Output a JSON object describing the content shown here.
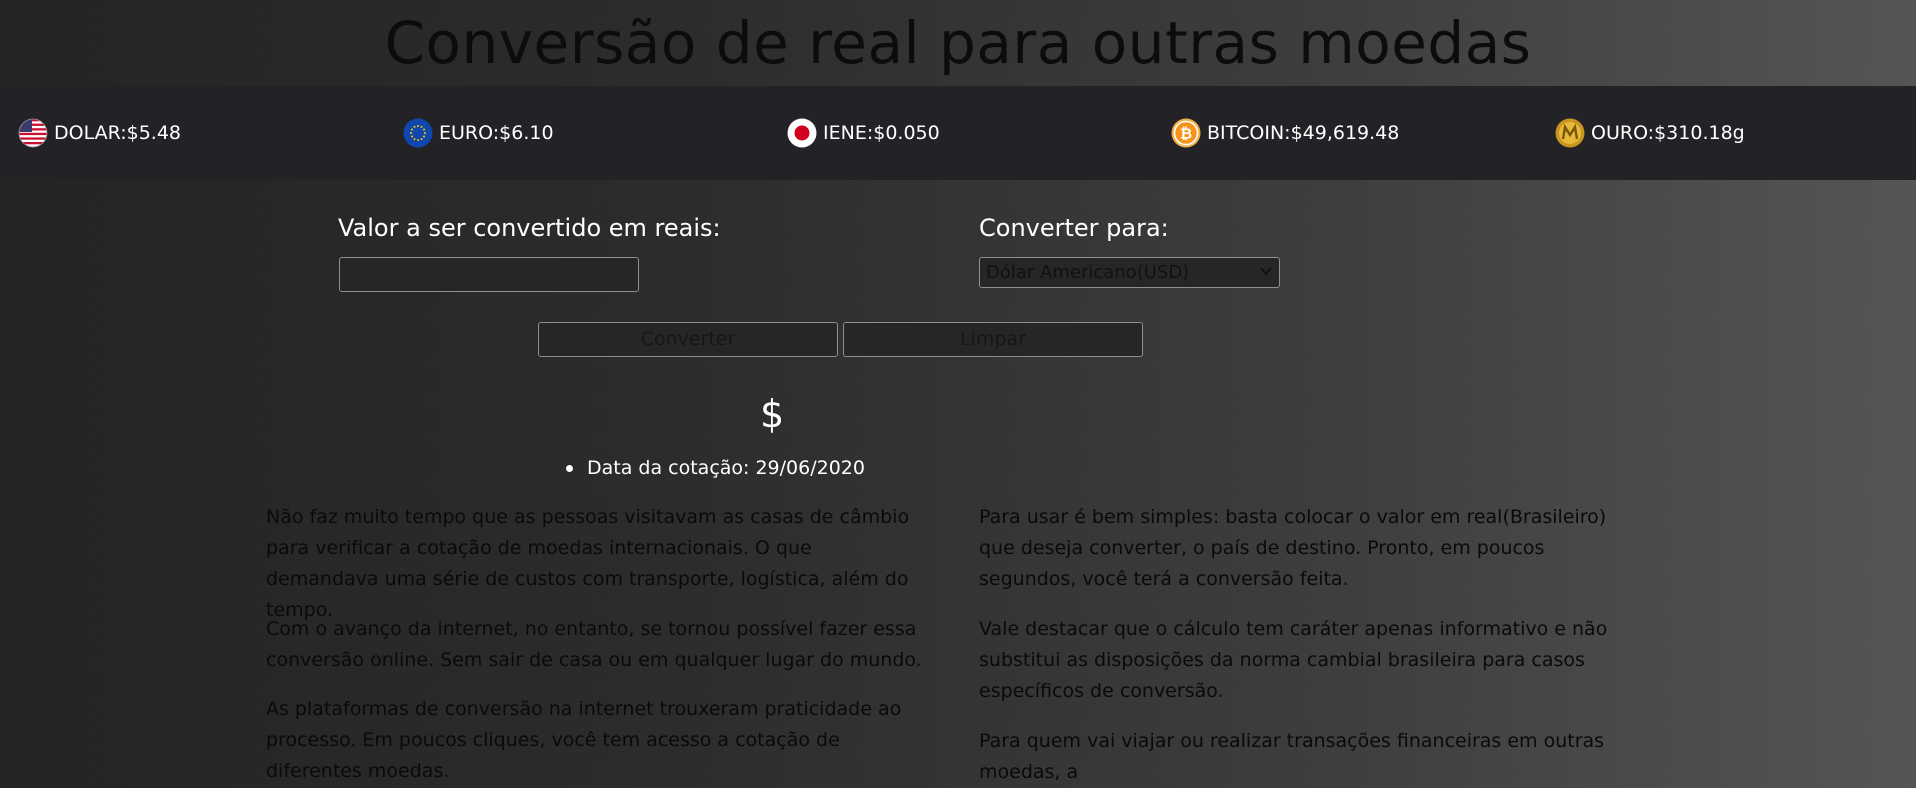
{
  "page": {
    "title": "Conversão de real para outras moedas"
  },
  "ticker": [
    {
      "icon": "us-flag-icon",
      "text": "DOLAR:$5.48"
    },
    {
      "icon": "eu-flag-icon",
      "text": "EURO:$6.10"
    },
    {
      "icon": "japan-flag-icon",
      "text": "IENE:$0.050"
    },
    {
      "icon": "bitcoin-icon",
      "text": "BITCOIN:$49,619.48"
    },
    {
      "icon": "gold-icon",
      "text": "OURO:$310.18g"
    }
  ],
  "form": {
    "amount_label": "Valor a ser convertido em reais:",
    "amount_value": "",
    "target_label": "Converter para:",
    "target_selected": "Dólar Americano(USD)",
    "convert_button": "Converter",
    "clear_button": "Limpar"
  },
  "result": {
    "symbol": "$",
    "quote_date": "Data da cotação: 29/06/2020"
  },
  "article": {
    "left": [
      "Não faz muito tempo que as pessoas visitavam as casas de câmbio para verificar a cotação de moedas internacionais. O que demandava uma série de custos com transporte, logística, além do tempo.",
      "Com o avanço da internet, no entanto, se tornou possível fazer essa conversão online. Sem sair de casa ou em qualquer lugar do mundo.",
      "As plataformas de conversão na internet trouxeram praticidade ao processo. Em poucos cliques, você tem acesso a cotação de diferentes moedas."
    ],
    "right": [
      "Para usar é bem simples: basta colocar o valor em real(Brasileiro) que deseja converter, o país de destino. Pronto, em poucos segundos, você terá a conversão feita.",
      "Vale destacar que o cálculo tem caráter apenas informativo e não substitui as disposições da norma cambial brasileira para casos específicos de conversão.",
      "Para quem vai viajar ou realizar transações financeiras em outras moedas, a"
    ]
  },
  "colors": {
    "ticker_bg": "#232226",
    "title_text": "#0c0c0c",
    "body_text": "#0a0a0a",
    "field_bg": "#262626"
  }
}
